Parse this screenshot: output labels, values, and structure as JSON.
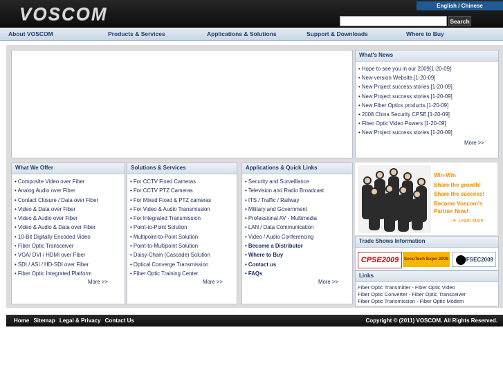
{
  "header": {
    "logo_text": "VOSCOM",
    "language_link": "English / Chinese",
    "search_placeholder": "",
    "search_button": "Search"
  },
  "nav": {
    "items": [
      "About VOSCOM",
      "Products & Services",
      "Applications & Solutions",
      "Support & Downloads",
      "Where to Buy"
    ]
  },
  "news": {
    "title": "What's News",
    "items": [
      "Hope to see you in our 2009[1-20-09]",
      "New version Website.[1-20-09]",
      "New Project success stories.[1-20-09]",
      "New Project success stories.[1-20-09]",
      "New Fiber Optics products.[1-20-09]",
      "2008 China Security CPSE.[1-20-09]",
      "Fiber Optic Video Powers [1-20-09]",
      "New Project success stories.[1-20-09]"
    ],
    "more": "More >>"
  },
  "offer": {
    "title": "What We Offer",
    "items": [
      "Composite Video over Fiber",
      "Analog Audio over Fiber",
      "Contact Closure / Data over Fiber",
      "Video & Data over Fiber",
      "Video & Audio over Fiber",
      "Video & Audio & Data over Fiber",
      "10-Bit Digitally Encoded Video",
      "Fiber Optic Transceiver",
      "VGA/ DVI / HDMI over Fiber",
      "SDI / ASI / HD-SDI over Fiber",
      "Fiber Optic Integrated Platform"
    ],
    "more": "More >>"
  },
  "solutions": {
    "title": "Solutions & Services",
    "items": [
      "For CCTV Fixed Cameras",
      "For CCTV PTZ Cameras",
      "For Mixed Fixed & PTZ cameras",
      "For Video & Audio Transmission",
      "For Integrated Transmission",
      "Point-to-Point Solution",
      "Multipoint-to-Point Solution",
      "Point-to-Multipoint Solution",
      "Daisy-Chain (Cascade) Solution",
      "Optical Converge Transmission",
      "Fiber Optic Training Center"
    ],
    "more": "More >>"
  },
  "apps": {
    "title": "Applications & Quick Links",
    "items": [
      "Security and Surveillance",
      "Television and Radio Broadcast",
      "ITS / Traffic / Railway",
      "Military and Government",
      "Professional AV - Multimedia",
      "LAN / Data Communication",
      "Video / Audio Conferencing",
      "Become a Distributor",
      "Where to Buy",
      "Contact us",
      "FAQs"
    ],
    "more": "More >>"
  },
  "promo": {
    "lines": [
      "Win-Win",
      "Share the growth!",
      "Share the success!",
      "Become Voscom's",
      "Partner Now!"
    ],
    "learn_more": "Learn More"
  },
  "trade_shows": {
    "title": "Trade Shows Information",
    "logos": [
      "CPSE2009",
      "SecuTech Expo 2009",
      "IFSEC2009"
    ]
  },
  "links": {
    "title": "Links",
    "items": [
      "Fiber Optic Transmitter - Fiber Optic Video",
      "Fiber Optic Converter - Fiber Optic Transceiver",
      "Fiber Optic Transmission - Fiber Optic Modem"
    ]
  },
  "footer": {
    "links": [
      "Home",
      "Sitemap",
      "Legal & Privacy",
      "Contact Us"
    ],
    "copyright": "Copyright © (2011) VOSCOM. All Rights Reserved."
  }
}
